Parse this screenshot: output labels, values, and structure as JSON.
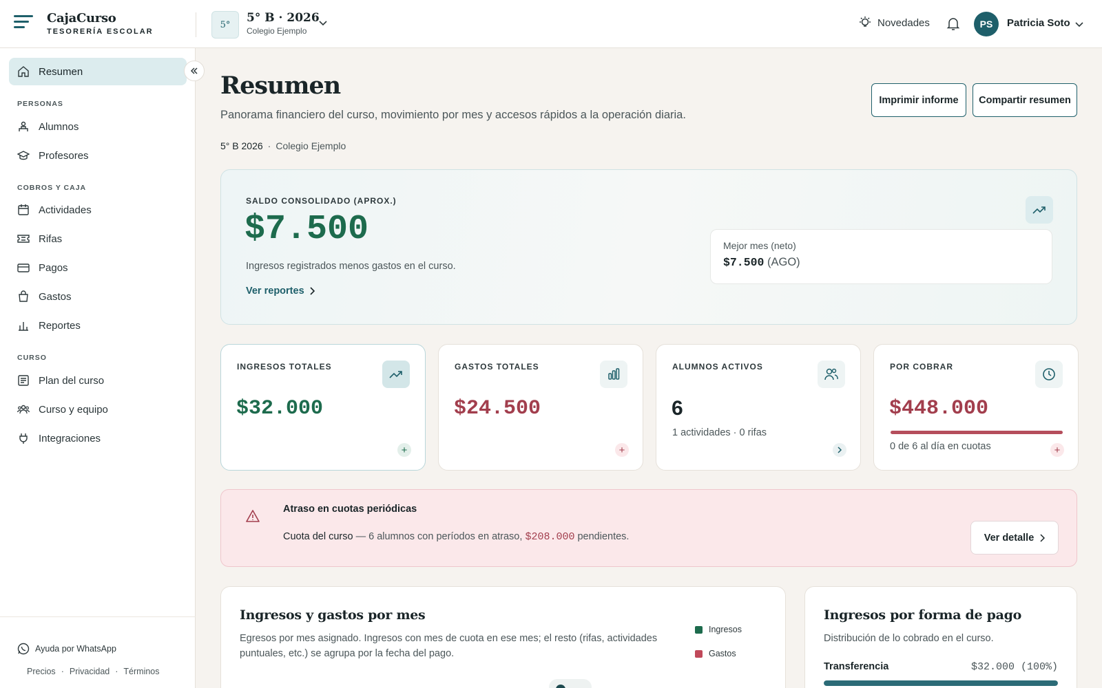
{
  "header": {
    "brand_name": "CajaCurso",
    "brand_sub": "TESORERÍA ESCOLAR",
    "course_badge": "5°",
    "course_title": "5° B · 2026",
    "course_school": "Colegio Ejemplo",
    "novedades": "Novedades",
    "user_initials": "PS",
    "user_name": "Patricia Soto"
  },
  "sidebar": {
    "active": "Resumen",
    "sections": {
      "personas": "PERSONAS",
      "cobros": "COBROS Y CAJA",
      "curso": "CURSO"
    },
    "items": {
      "resumen": "Resumen",
      "alumnos": "Alumnos",
      "profesores": "Profesores",
      "actividades": "Actividades",
      "rifas": "Rifas",
      "pagos": "Pagos",
      "gastos": "Gastos",
      "reportes": "Reportes",
      "plan": "Plan del curso",
      "equipo": "Curso y equipo",
      "integraciones": "Integraciones"
    },
    "whatsapp": "Ayuda por WhatsApp",
    "footer_links": [
      "Precios",
      "Privacidad",
      "Términos"
    ]
  },
  "page": {
    "title": "Resumen",
    "description": "Panorama financiero del curso, movimiento por mes y accesos rápidos a la operación diaria.",
    "meta_course": "5° B 2026",
    "meta_sep": "·",
    "meta_school": "Colegio Ejemplo",
    "print_button": "Imprimir informe",
    "share_button": "Compartir resumen"
  },
  "hero": {
    "label": "SALDO CONSOLIDADO (APROX.)",
    "value": "$7.500",
    "description": "Ingresos registrados menos gastos en el curso.",
    "link": "Ver reportes",
    "best_month_label": "Mejor mes (neto)",
    "best_month_value": "$7.500",
    "best_month_period": "(AGO)"
  },
  "stats": [
    {
      "label": "INGRESOS TOTALES",
      "value": "$32.000",
      "color": "#1d6b4d",
      "action": "+"
    },
    {
      "label": "GASTOS TOTALES",
      "value": "$24.500",
      "color": "#a23e4d",
      "action": "+"
    },
    {
      "label": "ALUMNOS ACTIVOS",
      "value": "6",
      "color": "#1a2528",
      "sub": "1 actividades · 0 rifas"
    },
    {
      "label": "POR COBRAR",
      "value": "$448.000",
      "color": "#a23e4d",
      "sub": "0 de 6 al día en cuotas",
      "progress": 1.0,
      "action": "+"
    }
  ],
  "alert": {
    "title": "Atraso en cuotas periódicas",
    "strong": "Cuota del curso",
    "text_before": " — 6 alumnos con períodos en atraso, ",
    "amount": "$208.000",
    "text_after": " pendientes.",
    "button": "Ver detalle"
  },
  "chart_panel": {
    "title": "Ingresos y gastos por mes",
    "description": "Egresos por mes asignado. Ingresos con mes de cuota en ese mes; el resto (rifas, actividades puntuales, etc.) se agrupa por la fecha del pago.",
    "legend": [
      "Ingresos",
      "Gastos"
    ],
    "legend_colors": [
      "#1d6b4d",
      "#c0495a"
    ]
  },
  "payment_panel": {
    "title": "Ingresos por forma de pago",
    "description": "Distribución de lo cobrado en el curso.",
    "rows": [
      {
        "label": "Transferencia",
        "value": "$32.000 (100%)",
        "share": 1.0
      }
    ]
  }
}
